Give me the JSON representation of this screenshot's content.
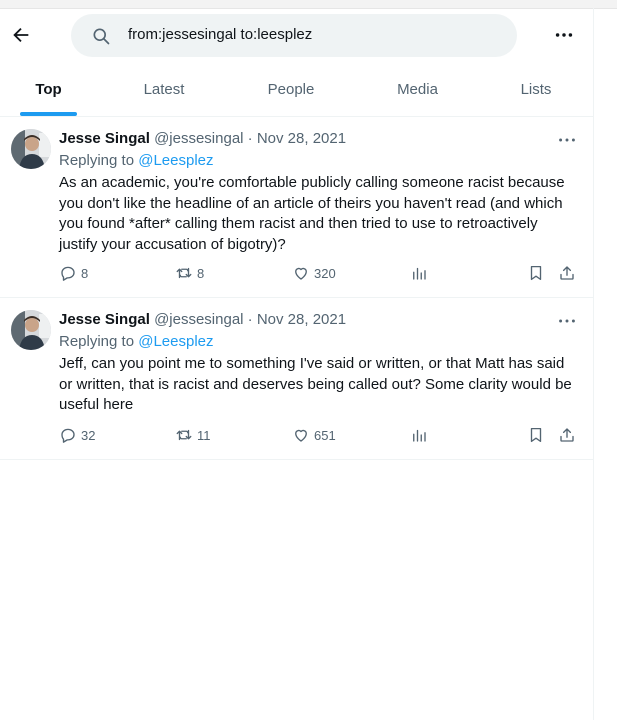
{
  "search": {
    "query": "from:jessesingal to:leesplez"
  },
  "tabs": [
    "Top",
    "Latest",
    "People",
    "Media",
    "Lists"
  ],
  "tweets": [
    {
      "name": "Jesse Singal",
      "handle": "@jessesingal",
      "sep": "·",
      "date": "Nov 28, 2021",
      "replying_prefix": "Replying to",
      "replying_to": "@Leesplez",
      "text": "As an academic, you're comfortable publicly calling someone racist because you don't like the headline of an article of theirs you haven't read (and which you found *after* calling them racist and then tried to use to retroactively justify your accusation of bigotry)?",
      "replies": "8",
      "retweets": "8",
      "likes": "320"
    },
    {
      "name": "Jesse Singal",
      "handle": "@jessesingal",
      "sep": "·",
      "date": "Nov 28, 2021",
      "replying_prefix": "Replying to",
      "replying_to": "@Leesplez",
      "text": "Jeff, can you point me to something I've said or written, or that Matt has said or written, that is racist and deserves being called out? Some clarity would be useful here",
      "replies": "32",
      "retweets": "11",
      "likes": "651"
    }
  ],
  "colors": {
    "accent": "#1d9bf0",
    "muted": "#536471",
    "text": "#0f1419"
  }
}
